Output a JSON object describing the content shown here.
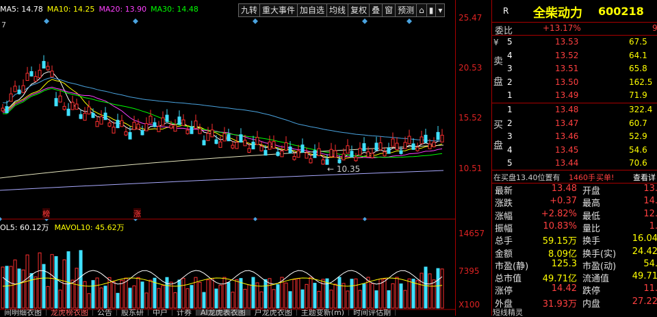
{
  "legend": {
    "items": [
      {
        "label": "MA5: 14.78",
        "color": "#ffffff"
      },
      {
        "label": "MA10: 14.25",
        "color": "#ffff00"
      },
      {
        "label": "MA20: 13.90",
        "color": "#ff40ff"
      },
      {
        "label": "MA30: 14.48",
        "color": "#00ff00"
      }
    ]
  },
  "toolbar": {
    "buttons": [
      "九转",
      "重大事件",
      "加自选",
      "均线",
      "复权",
      "叠",
      "窗",
      "预测"
    ]
  },
  "chart": {
    "top_tick": "7",
    "min_label": "10.35",
    "markers": [
      "榜",
      "涨"
    ],
    "volume_legend": [
      "OL5: 60.12万",
      "MAVOL10: 45.62万"
    ]
  },
  "price_axis": {
    "labels": [
      "25.47",
      "20.53",
      "15.52",
      "10.51",
      "14657",
      "7395",
      "X100"
    ]
  },
  "header": {
    "r_label": "R",
    "stock_name": "全柴动力",
    "stock_code": "600218"
  },
  "order_book": {
    "weibi_label": "委比",
    "weibi_value": "+13.17%",
    "weibi_extra": "9",
    "sell_label": "卖盘",
    "buy_label": "买盘",
    "sell": [
      {
        "level": "5",
        "price": "13.53",
        "volume": "67.5"
      },
      {
        "level": "4",
        "price": "13.52",
        "volume": "64.1"
      },
      {
        "level": "3",
        "price": "13.51",
        "volume": "65.8"
      },
      {
        "level": "2",
        "price": "13.50",
        "volume": "162.5"
      },
      {
        "level": "1",
        "price": "13.49",
        "volume": "71.9"
      }
    ],
    "buy": [
      {
        "level": "1",
        "price": "13.48",
        "volume": "322.4"
      },
      {
        "level": "2",
        "price": "13.47",
        "volume": "60.7"
      },
      {
        "level": "3",
        "price": "13.46",
        "volume": "52.9"
      },
      {
        "level": "4",
        "price": "13.45",
        "volume": "54.6"
      },
      {
        "level": "5",
        "price": "13.44",
        "volume": "70.6"
      }
    ],
    "note": "在买盘13.40位置有",
    "note_qty": "1460手",
    "note_action": "买单!",
    "note_link": "查看详"
  },
  "stats": [
    {
      "l1": "最新",
      "v1": "13.48",
      "l2": "开盘",
      "v2": "13."
    },
    {
      "l1": "涨跌",
      "v1": "+0.37",
      "l2": "最高",
      "v2": "14."
    },
    {
      "l1": "涨幅",
      "v1": "+2.82%",
      "l2": "最低",
      "v2": "12."
    },
    {
      "l1": "振幅",
      "v1": "10.83%",
      "l2": "量比",
      "v2": "1."
    },
    {
      "l1": "总手",
      "v1": "59.15万",
      "l2": "换手",
      "v2": "16.04"
    },
    {
      "l1": "金额",
      "v1": "8.09亿",
      "l2": "换手(实)",
      "v2": "24.42"
    },
    {
      "l1": "市盈(静)",
      "v1": "125.3",
      "l2": "市盈(动)",
      "v2": "54."
    },
    {
      "l1": "总市值",
      "v1": "49.71亿",
      "l2": "流通值",
      "v2": "49.71"
    },
    {
      "l1": "涨停",
      "v1": "14.42",
      "l2": "跌停",
      "v2": "11."
    },
    {
      "l1": "外盘",
      "v1": "31.93万",
      "l2": "内盘",
      "v2": "27.22"
    }
  ],
  "bottom_tabs": [
    "间明细衣图",
    "龙虎榜衣图",
    "公告",
    "股东研",
    "中户",
    "计券",
    "AI龙虎表衣图",
    "户龙虎衣图",
    "主题变新(m)",
    "时间评估期"
  ],
  "bottom_right": "短线精灵"
}
